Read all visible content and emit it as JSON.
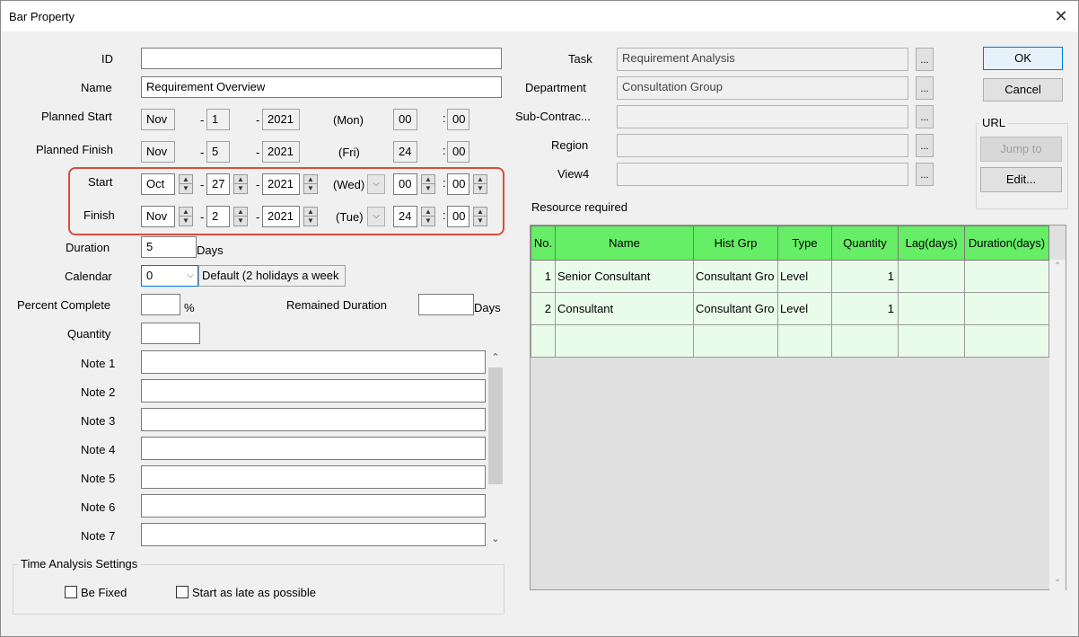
{
  "window": {
    "title": "Bar Property",
    "close_symbol": "✕"
  },
  "left": {
    "id_label": "ID",
    "id_value": "",
    "name_label": "Name",
    "name_value": "Requirement Overview",
    "planned_start": {
      "label": "Planned Start",
      "month": "Nov",
      "day": "1",
      "year": "2021",
      "dow": "(Mon)",
      "hour": "00",
      "minute": "00"
    },
    "planned_finish": {
      "label": "Planned Finish",
      "month": "Nov",
      "day": "5",
      "year": "2021",
      "dow": "(Fri)",
      "hour": "24",
      "minute": "00"
    },
    "start": {
      "label": "Start",
      "month": "Oct",
      "day": "27",
      "year": "2021",
      "dow": "(Wed)",
      "hour": "00",
      "minute": "00"
    },
    "finish": {
      "label": "Finish",
      "month": "Nov",
      "day": "2",
      "year": "2021",
      "dow": "(Tue)",
      "hour": "24",
      "minute": "00"
    },
    "dash": "-",
    "colon": ":",
    "duration_label": "Duration",
    "duration_value": "5",
    "duration_unit": "Days",
    "calendar_label": "Calendar",
    "calendar_value": "0",
    "calendar_desc": "Default (2 holidays a week",
    "percent_label": "Percent Complete",
    "percent_value": "",
    "percent_unit": "%",
    "remained_label": "Remained Duration",
    "remained_value": "",
    "remained_unit": "Days",
    "quantity_label": "Quantity",
    "quantity_value": "",
    "notes": [
      {
        "label": "Note 1",
        "value": ""
      },
      {
        "label": "Note 2",
        "value": ""
      },
      {
        "label": "Note 3",
        "value": ""
      },
      {
        "label": "Note 4",
        "value": ""
      },
      {
        "label": "Note 5",
        "value": ""
      },
      {
        "label": "Note 6",
        "value": ""
      },
      {
        "label": "Note 7",
        "value": ""
      }
    ],
    "time_analysis": {
      "title": "Time Analysis Settings",
      "be_fixed": "Be Fixed",
      "start_late": "Start as late as possible"
    }
  },
  "right": {
    "task_label": "Task",
    "task_value": "Requirement Analysis",
    "dept_label": "Department",
    "dept_value": "Consultation Group",
    "sub_label": "Sub-Contrac...",
    "sub_value": "",
    "region_label": "Region",
    "region_value": "",
    "view4_label": "View4",
    "view4_value": "",
    "ellipsis": "...",
    "resource_label": "Resource required",
    "table": {
      "headers": [
        "No.",
        "Name",
        "Hist Grp",
        "Type",
        "Quantity",
        "Lag(days)",
        "Duration(days)"
      ],
      "rows": [
        [
          "1",
          "Senior Consultant",
          "Consultant Gro",
          "Level",
          "1",
          "",
          ""
        ],
        [
          "2",
          "Consultant",
          "Consultant Gro",
          "Level",
          "1",
          "",
          ""
        ]
      ]
    }
  },
  "buttons": {
    "ok": "OK",
    "cancel": "Cancel",
    "url_group": "URL",
    "jump_to": "Jump to",
    "edit": "Edit..."
  },
  "colors": {
    "grid_header": "#66ee66",
    "grid_row": "#e9fbe9",
    "highlight": "#d94d3a",
    "ok_border": "#0078d7"
  }
}
